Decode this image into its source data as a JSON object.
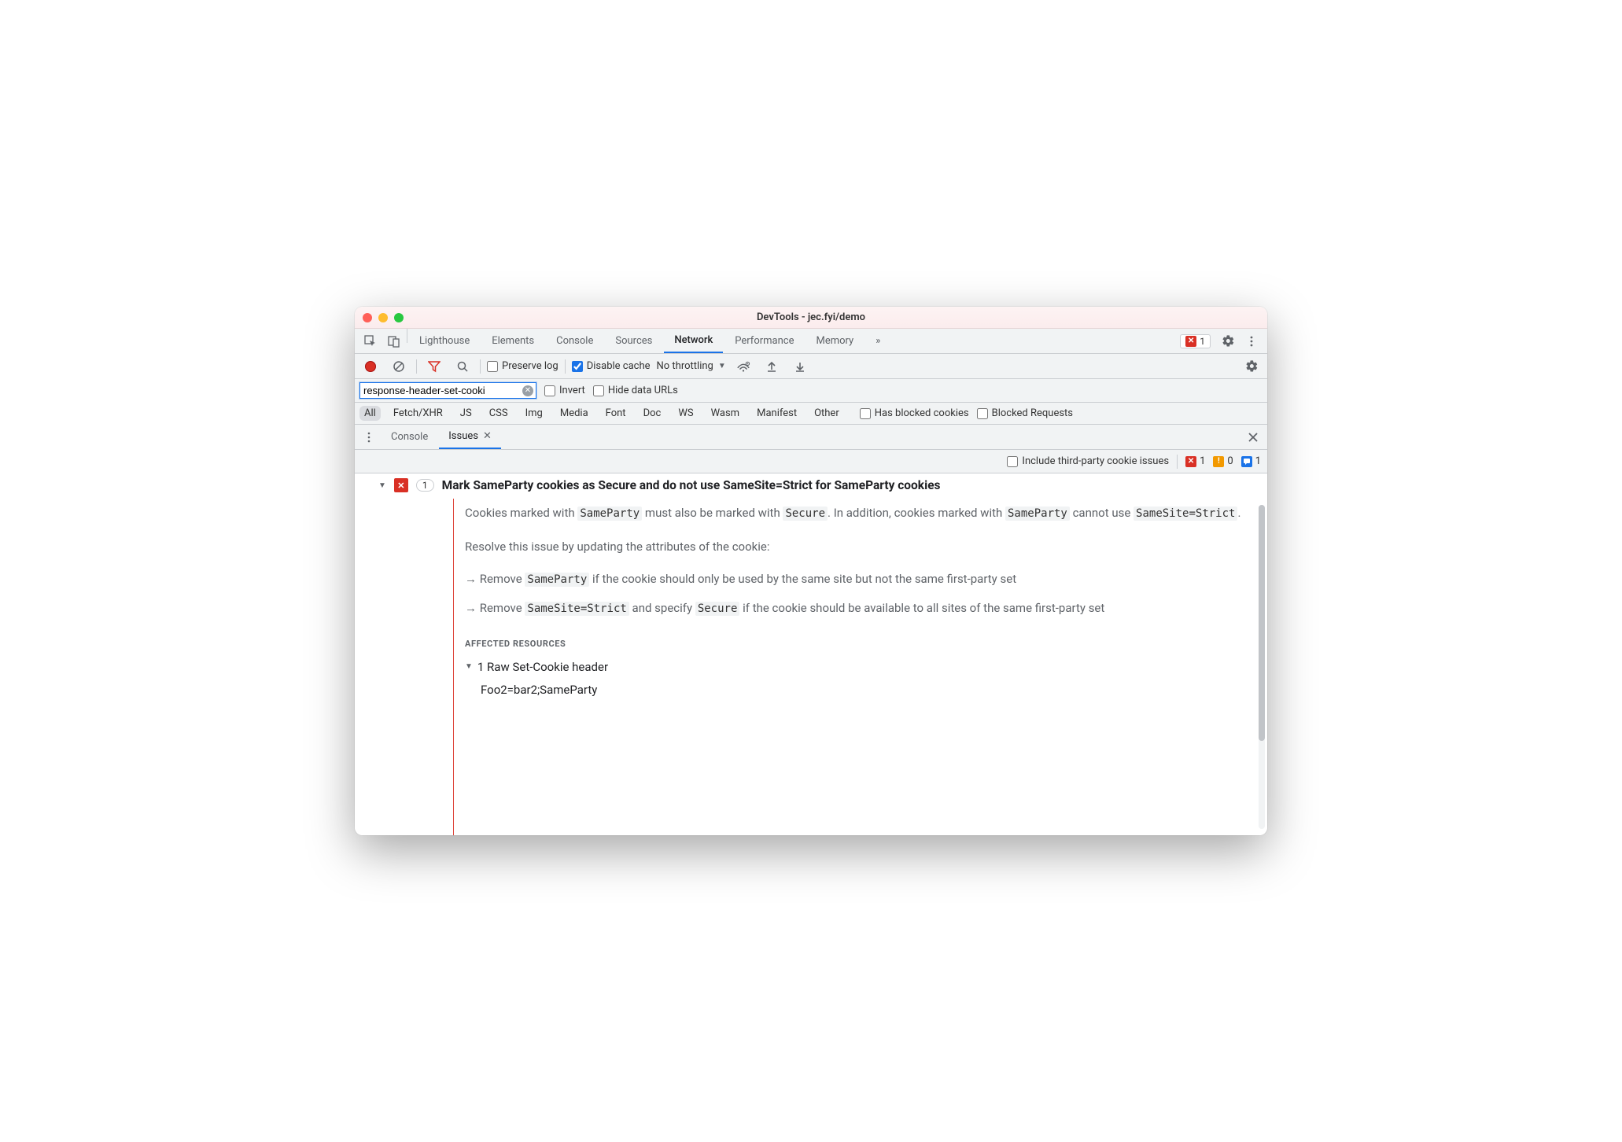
{
  "window": {
    "title": "DevTools - jec.fyi/demo"
  },
  "tabs": {
    "items": [
      "Lighthouse",
      "Elements",
      "Console",
      "Sources",
      "Network",
      "Performance",
      "Memory"
    ],
    "active": "Network",
    "overflow": "»",
    "error_count": "1"
  },
  "toolbar": {
    "preserve_log": "Preserve log",
    "disable_cache": "Disable cache",
    "throttling": "No throttling"
  },
  "filter": {
    "value": "response-header-set-cooki",
    "invert": "Invert",
    "hide_data_urls": "Hide data URLs"
  },
  "types": {
    "items": [
      "All",
      "Fetch/XHR",
      "JS",
      "CSS",
      "Img",
      "Media",
      "Font",
      "Doc",
      "WS",
      "Wasm",
      "Manifest",
      "Other"
    ],
    "active": "All",
    "has_blocked": "Has blocked cookies",
    "blocked_req": "Blocked Requests"
  },
  "drawer": {
    "tabs": {
      "console": "Console",
      "issues": "Issues"
    },
    "active": "Issues"
  },
  "issues": {
    "third_party": "Include third-party cookie issues",
    "counts": {
      "error": "1",
      "warn": "0",
      "info": "1"
    },
    "item": {
      "badge": "1",
      "title": "Mark SameParty cookies as Secure and do not use SameSite=Strict for SameParty cookies",
      "p1_a": "Cookies marked with ",
      "p1_code1": "SameParty",
      "p1_b": " must also be marked with ",
      "p1_code2": "Secure",
      "p1_c": ". In addition, cookies marked with ",
      "p1_code3": "SameParty",
      "p1_d": " cannot use ",
      "p1_code4": "SameSite=Strict",
      "p1_e": ".",
      "p2": "Resolve this issue by updating the attributes of the cookie:",
      "b1_a": "Remove ",
      "b1_code": "SameParty",
      "b1_b": " if the cookie should only be used by the same site but not the same first-party set",
      "b2_a": "Remove ",
      "b2_code1": "SameSite=Strict",
      "b2_b": " and specify ",
      "b2_code2": "Secure",
      "b2_c": " if the cookie should be available to all sites of the same first-party set",
      "affected_header": "AFFECTED RESOURCES",
      "affected_row": "1 Raw Set-Cookie header",
      "cookie_value": "Foo2=bar2;SameParty"
    }
  }
}
